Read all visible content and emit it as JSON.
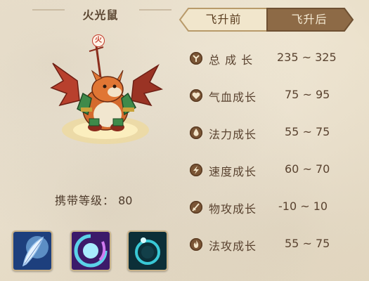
{
  "pet": {
    "name": "火光鼠",
    "element_badge": "火",
    "carry_level_label": "携带等级：",
    "carry_level_value": "80"
  },
  "tabs": {
    "before_label": "飞升前",
    "after_label": "飞升后",
    "active": "before"
  },
  "stats": [
    {
      "label": "总 成 长",
      "value": "235 ~ 325",
      "icon": "growth-icon"
    },
    {
      "label": "气血成长",
      "value": "75 ~ 95",
      "icon": "heart-icon"
    },
    {
      "label": "法力成长",
      "value": "55 ~ 75",
      "icon": "mana-drop-icon"
    },
    {
      "label": "速度成长",
      "value": "60 ~ 70",
      "icon": "speed-icon"
    },
    {
      "label": "物攻成长",
      "value": "-10 ~ 10",
      "icon": "sword-icon"
    },
    {
      "label": "法攻成长",
      "value": "55 ~ 75",
      "icon": "flame-icon"
    }
  ],
  "skills": [
    {
      "icon": "feather-skill-icon",
      "color": "#2a5fa8"
    },
    {
      "icon": "orb-skill-icon",
      "color": "#6a2fa0"
    },
    {
      "icon": "ring-skill-icon",
      "color": "#1b8a9a"
    }
  ]
}
